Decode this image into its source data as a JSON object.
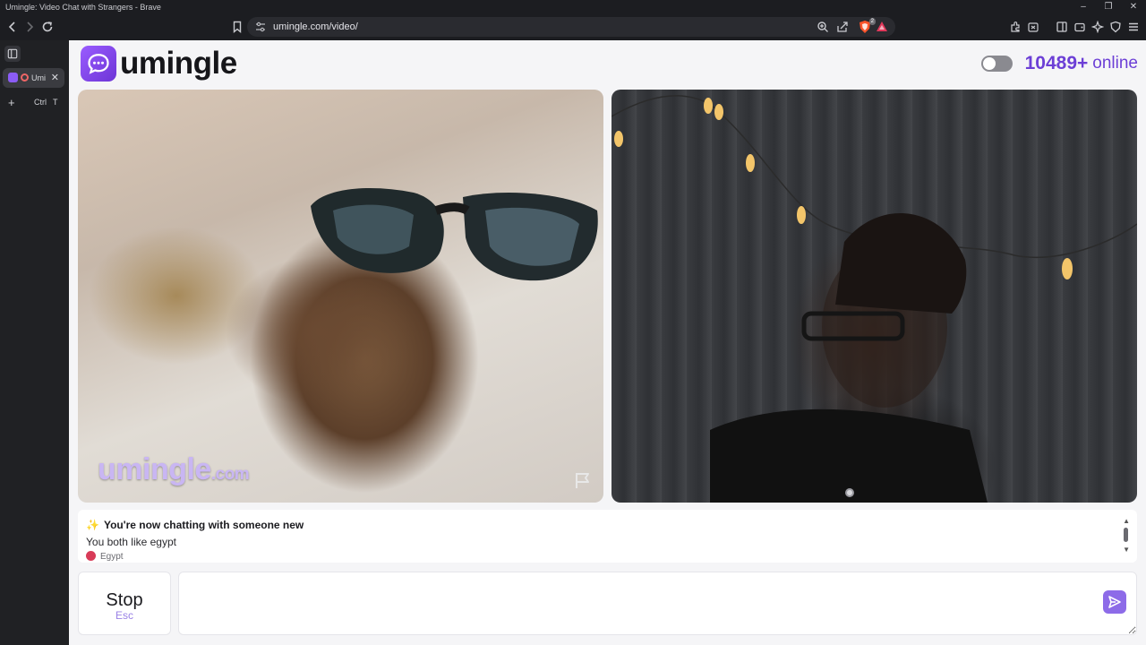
{
  "browser": {
    "window_title": "Umingle: Video Chat with Strangers - Brave",
    "url": "umingle.com/video/",
    "shields_count": "2",
    "tab": {
      "title": "Umi"
    },
    "new_tab_keys": [
      "Ctrl",
      "T"
    ]
  },
  "header": {
    "logo_text": "umingle",
    "online_count": "10489+",
    "online_label": "online"
  },
  "video": {
    "watermark_main": "umingle",
    "watermark_suffix": ".com"
  },
  "chat": {
    "line1_icon": "✨",
    "line1": "You're now chatting with someone new",
    "line2": "You both like egypt",
    "line3": "Egypt"
  },
  "controls": {
    "stop_label": "Stop",
    "stop_key": "Esc",
    "message_value": ""
  },
  "colors": {
    "brand": "#6c3fd6",
    "accent": "#8d6be8",
    "page_bg": "#f5f5f7"
  }
}
